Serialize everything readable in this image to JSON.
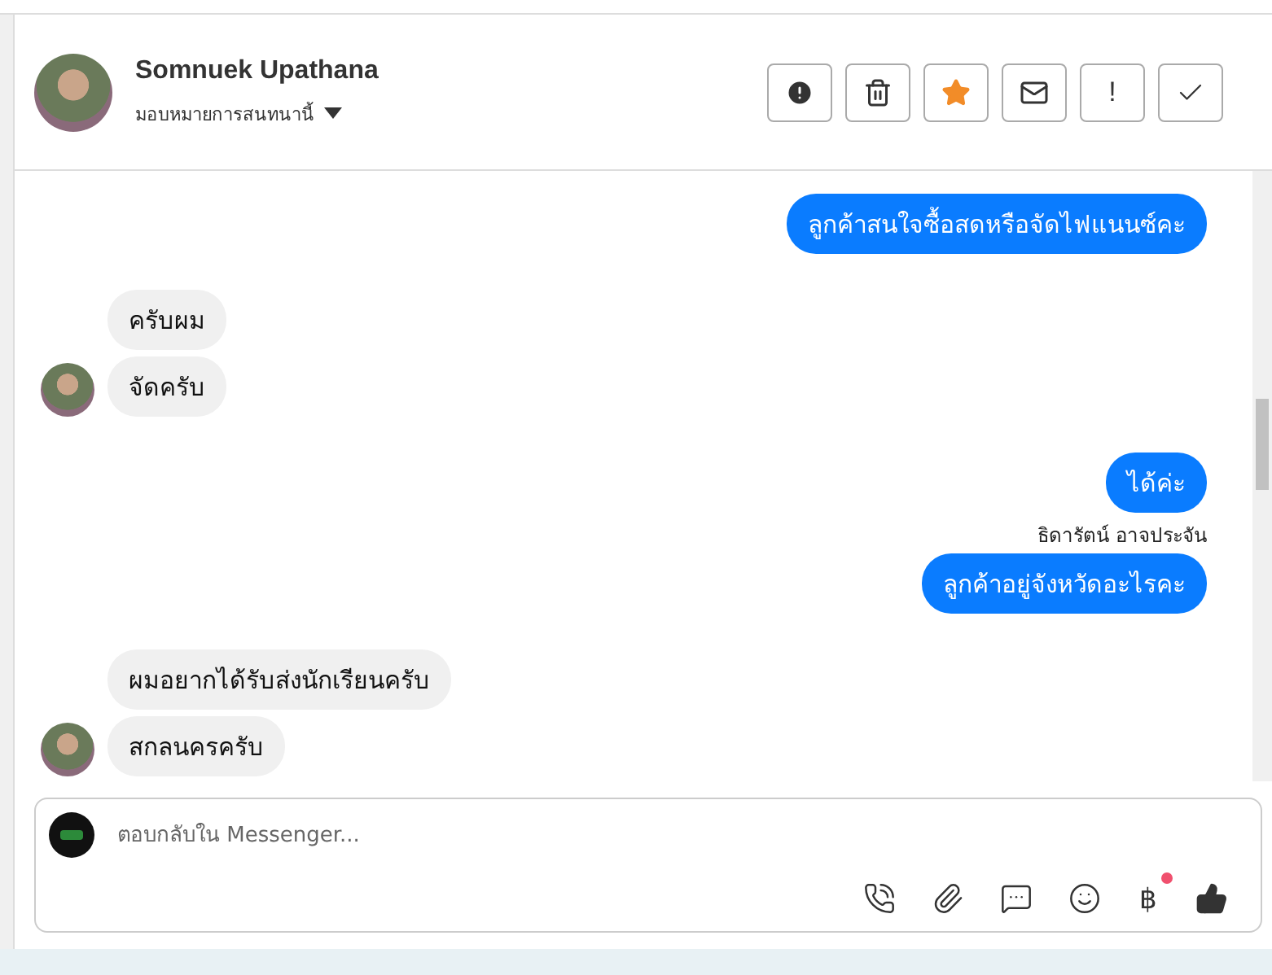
{
  "header": {
    "name": "Somnuek Upathana",
    "assign_label": "มอบหมายการสนทนานี้"
  },
  "actions": [
    {
      "kind": "alert"
    },
    {
      "kind": "trash"
    },
    {
      "kind": "star",
      "active": true
    },
    {
      "kind": "mail"
    },
    {
      "kind": "text",
      "label": "!"
    },
    {
      "kind": "check"
    }
  ],
  "messages": [
    {
      "kind": "outgoing",
      "text": "ลูกค้าสนใจซื้อสดหรือจัดไฟแนนซ์คะ"
    },
    {
      "kind": "incoming",
      "text": "ครับผม",
      "avatar": false
    },
    {
      "kind": "incoming",
      "text": "จัดครับ",
      "avatar": true
    },
    {
      "kind": "outgoing",
      "text": "ได้ค่ะ"
    },
    {
      "kind": "sender",
      "text": "ธิดารัตน์ อาจประจัน"
    },
    {
      "kind": "outgoing",
      "text": "ลูกค้าอยู่จังหวัดอะไรคะ"
    },
    {
      "kind": "incoming",
      "text": "ผมอยากได้รับส่งนักเรียนครับ",
      "avatar": false
    },
    {
      "kind": "incoming",
      "text": "สกลนครครับ",
      "avatar": true
    }
  ],
  "composer": {
    "placeholder": "ตอบกลับใน Messenger..."
  },
  "tools": [
    {
      "kind": "call"
    },
    {
      "kind": "attach"
    },
    {
      "kind": "reply"
    },
    {
      "kind": "emoji"
    },
    {
      "kind": "text",
      "label": "฿",
      "badge": true
    },
    {
      "kind": "like"
    }
  ]
}
